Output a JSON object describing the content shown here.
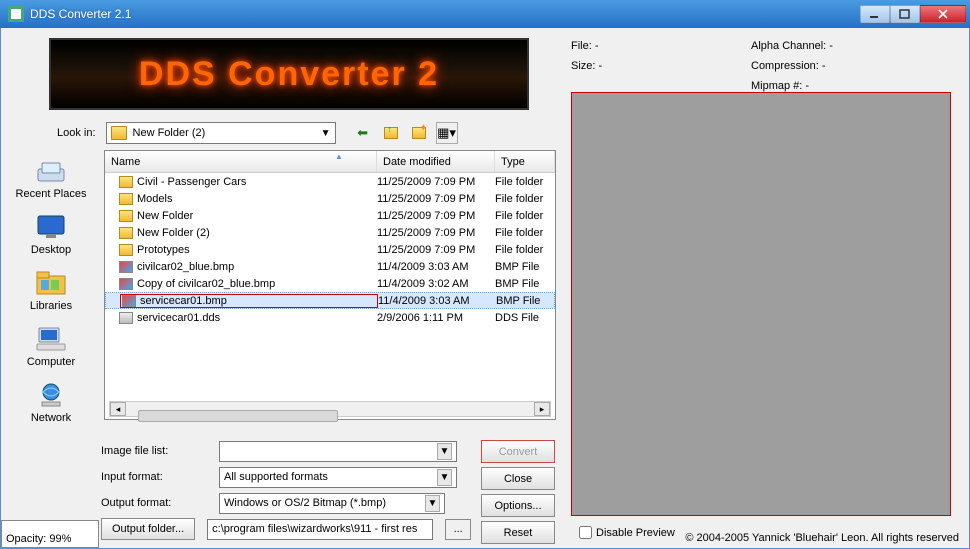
{
  "window": {
    "title": "DDS Converter 2.1"
  },
  "banner": "DDS Converter 2",
  "info": {
    "file_label": "File:",
    "file_value": "-",
    "size_label": "Size:",
    "size_value": "-",
    "alpha_label": "Alpha Channel:",
    "alpha_value": "-",
    "compression_label": "Compression:",
    "compression_value": "-",
    "mipmap_label": "Mipmap #:",
    "mipmap_value": "-"
  },
  "lookin": {
    "label": "Look in:",
    "value": "New Folder (2)"
  },
  "places": {
    "recent": "Recent Places",
    "desktop": "Desktop",
    "libraries": "Libraries",
    "computer": "Computer",
    "network": "Network"
  },
  "columns": {
    "name": "Name",
    "date": "Date modified",
    "type": "Type"
  },
  "files": [
    {
      "name": "Civil - Passenger Cars",
      "date": "11/25/2009 7:09 PM",
      "type": "File folder",
      "icon": "folder"
    },
    {
      "name": "Models",
      "date": "11/25/2009 7:09 PM",
      "type": "File folder",
      "icon": "folder"
    },
    {
      "name": "New Folder",
      "date": "11/25/2009 7:09 PM",
      "type": "File folder",
      "icon": "folder"
    },
    {
      "name": "New Folder (2)",
      "date": "11/25/2009 7:09 PM",
      "type": "File folder",
      "icon": "folder"
    },
    {
      "name": "Prototypes",
      "date": "11/25/2009 7:09 PM",
      "type": "File folder",
      "icon": "folder"
    },
    {
      "name": "civilcar02_blue.bmp",
      "date": "11/4/2009 3:03 AM",
      "type": "BMP File",
      "icon": "bmp"
    },
    {
      "name": "Copy of civilcar02_blue.bmp",
      "date": "11/4/2009 3:02 AM",
      "type": "BMP File",
      "icon": "bmp"
    },
    {
      "name": "servicecar01.bmp",
      "date": "11/4/2009 3:03 AM",
      "type": "BMP File",
      "icon": "bmp",
      "selected": true
    },
    {
      "name": "servicecar01.dds",
      "date": "2/9/2006 1:11 PM",
      "type": "DDS File",
      "icon": "dds"
    }
  ],
  "form": {
    "image_file_list": "Image file list:",
    "image_file_value": "",
    "input_format": "Input format:",
    "input_format_value": "All supported formats",
    "output_format": "Output format:",
    "output_format_value": "Windows or OS/2 Bitmap (*.bmp)",
    "output_folder_btn": "Output folder...",
    "output_folder_value": "c:\\program files\\wizardworks\\911 - first res",
    "browse_btn": "..."
  },
  "buttons": {
    "convert": "Convert",
    "close": "Close",
    "options": "Options...",
    "reset": "Reset"
  },
  "disable_preview": "Disable Preview",
  "copyright": "© 2004-2005 Yannick 'Bluehair' Leon. All rights reserved",
  "opacity": "Opacity: 99%"
}
